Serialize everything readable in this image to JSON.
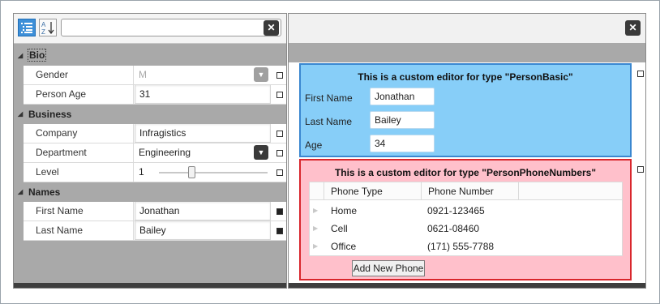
{
  "left": {
    "search": {
      "value": "",
      "placeholder": ""
    },
    "clear_label": "✕",
    "categories": [
      {
        "name": "Bio",
        "properties": [
          {
            "label": "Gender",
            "value": "M",
            "editor": "combo-disabled",
            "check": "empty"
          },
          {
            "label": "Person Age",
            "value": "31",
            "editor": "text",
            "check": "empty"
          }
        ]
      },
      {
        "name": "Business",
        "properties": [
          {
            "label": "Company",
            "value": "Infragistics",
            "editor": "text",
            "check": "empty"
          },
          {
            "label": "Department",
            "value": "Engineering",
            "editor": "combo",
            "check": "empty"
          },
          {
            "label": "Level",
            "value": "1",
            "editor": "slider",
            "slider_fraction": 0.3,
            "check": "empty"
          }
        ]
      },
      {
        "name": "Names",
        "properties": [
          {
            "label": "First Name",
            "value": "Jonathan",
            "editor": "text",
            "check": "filled"
          },
          {
            "label": "Last Name",
            "value": "Bailey",
            "editor": "text",
            "check": "filled"
          }
        ]
      }
    ]
  },
  "right": {
    "clear_label": "✕",
    "basic_editor": {
      "title": "This is a custom editor for type \"PersonBasic\"",
      "fields": [
        {
          "label": "First Name",
          "value": "Jonathan"
        },
        {
          "label": "Last Name",
          "value": "Bailey"
        },
        {
          "label": "Age",
          "value": "34"
        }
      ]
    },
    "phone_editor": {
      "title": "This is a custom editor for type \"PersonPhoneNumbers\"",
      "columns": [
        "Phone Type",
        "Phone Number"
      ],
      "rows": [
        {
          "type": "Home",
          "number": "0921-123465"
        },
        {
          "type": "Cell",
          "number": "0621-08460"
        },
        {
          "type": "Office",
          "number": "(171) 555-7788"
        }
      ],
      "add_button": "Add New Phone"
    }
  },
  "colors": {
    "basic_bg": "#87cef8",
    "basic_border": "#3a87d0",
    "phone_bg": "#ffc0cb",
    "phone_border": "#d9262c",
    "category_bg": "#a9a9a9"
  }
}
